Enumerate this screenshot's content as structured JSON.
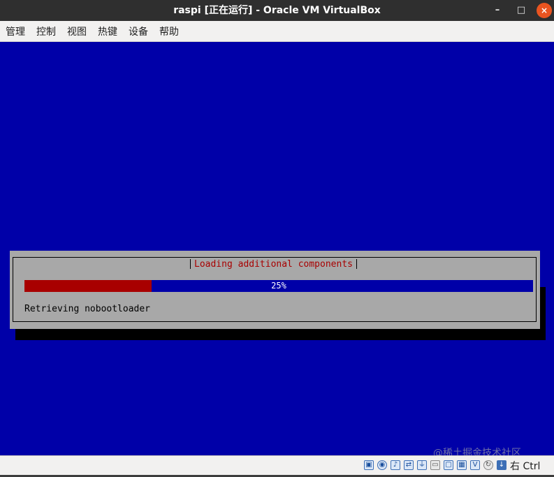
{
  "window": {
    "title": "raspi [正在运行] - Oracle VM VirtualBox",
    "controls": {
      "minimize": "–",
      "maximize": "□",
      "close": "×"
    }
  },
  "menubar": {
    "items": [
      {
        "label": "管理"
      },
      {
        "label": "控制"
      },
      {
        "label": "视图"
      },
      {
        "label": "热键"
      },
      {
        "label": "设备"
      },
      {
        "label": "帮助"
      }
    ]
  },
  "installer": {
    "dialog_title": "Loading additional components",
    "progress": {
      "percent": 25,
      "label": "25%"
    },
    "status": "Retrieving nobootloader"
  },
  "colors": {
    "screen_bg": "#0000a8",
    "dialog_bg": "#a8a8a8",
    "progress_fill": "#a80000",
    "title_text": "#a80000"
  },
  "watermark": "@稀土掘金技术社区",
  "statusbar": {
    "icons": [
      "hard-disk-icon",
      "optical-drive-icon",
      "audio-icon",
      "network-icon",
      "usb-icon",
      "shared-folders-icon",
      "display-icon",
      "recording-icon",
      "mouse-integration-icon",
      "keyboard-capture-icon"
    ],
    "host_key": "右 Ctrl"
  }
}
